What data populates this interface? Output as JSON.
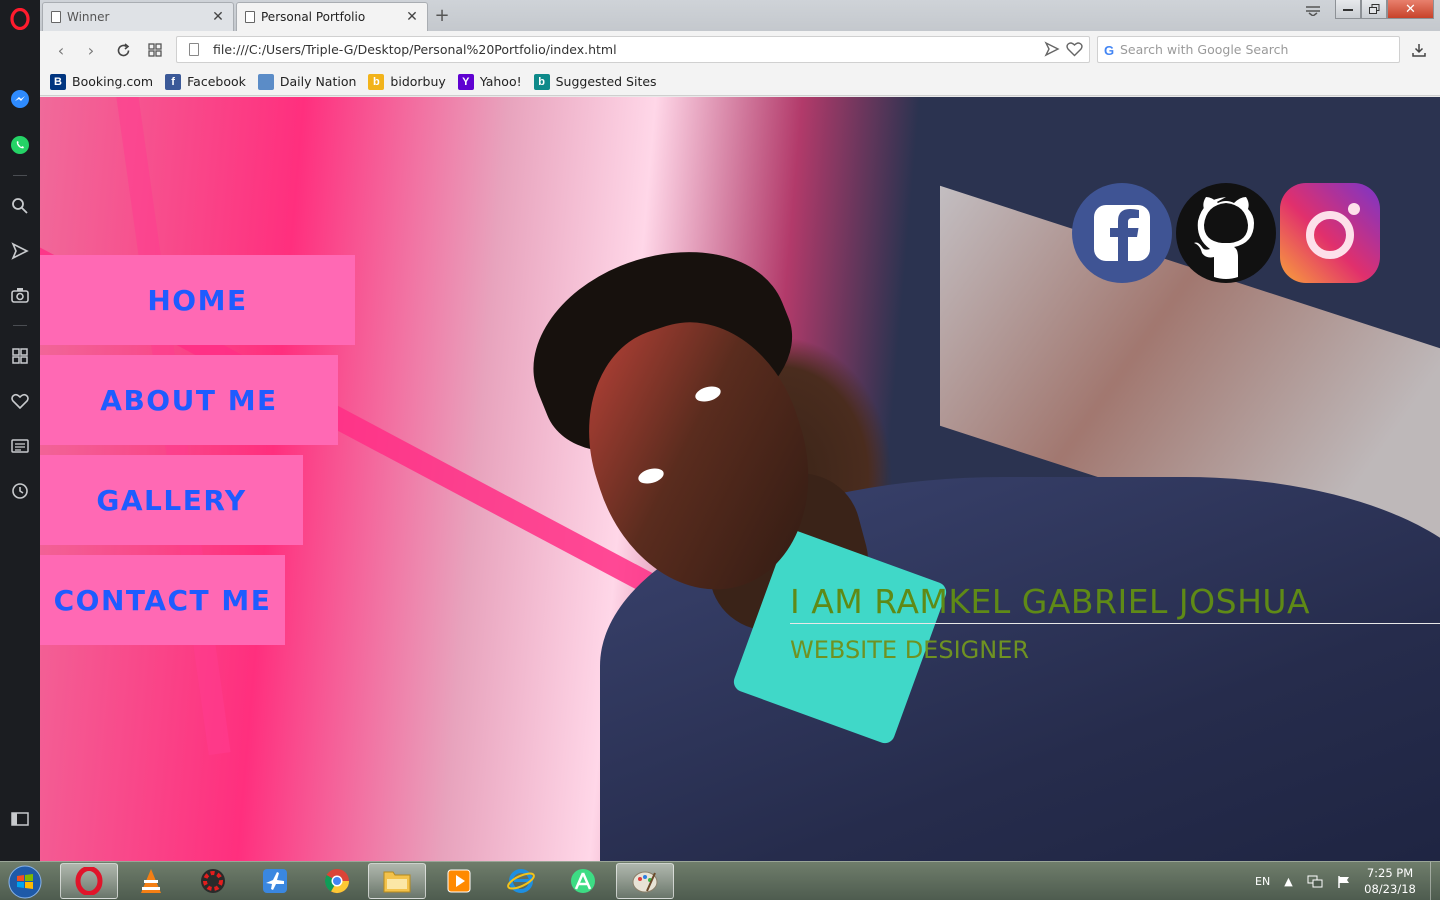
{
  "browser": {
    "tabs": [
      {
        "title": "Winner",
        "active": false
      },
      {
        "title": "Personal Portfolio",
        "active": true
      }
    ],
    "address": {
      "url": "file:///C:/Users/Triple-G/Desktop/Personal%20Portfolio/index.html"
    },
    "search": {
      "placeholder": "Search with Google Search"
    },
    "bookmarks": [
      {
        "label": "Booking.com",
        "icon": "booking-icon",
        "color": "#003580",
        "glyph": "B"
      },
      {
        "label": "Facebook",
        "icon": "facebook-icon",
        "color": "#3b5998",
        "glyph": "f"
      },
      {
        "label": "Daily Nation",
        "icon": "daily-nation-icon",
        "color": "#5b8cc7",
        "glyph": ""
      },
      {
        "label": "bidorbuy",
        "icon": "bidorbuy-icon",
        "color": "#f2b31a",
        "glyph": "b"
      },
      {
        "label": "Yahoo!",
        "icon": "yahoo-icon",
        "color": "#5f01d1",
        "glyph": "Y"
      },
      {
        "label": "Suggested Sites",
        "icon": "suggested-sites-icon",
        "color": "#0e8a8a",
        "glyph": "b"
      }
    ]
  },
  "page": {
    "nav": {
      "home": "HOME",
      "about": "ABOUT ME",
      "gallery": "GALLERY",
      "contact": "CONTACT ME"
    },
    "social": [
      "facebook-icon",
      "github-icon",
      "instagram-icon"
    ],
    "headline": "I AM RAMKEL GABRIEL JOSHUA",
    "subheadline": "WEBSITE DESIGNER",
    "colors": {
      "nav_bg": "#ff69b4",
      "nav_text": "#1e5cff",
      "headline": "#5f8a16"
    }
  },
  "taskbar": {
    "language": "EN",
    "time": "7:25 PM",
    "date": "08/23/18"
  }
}
